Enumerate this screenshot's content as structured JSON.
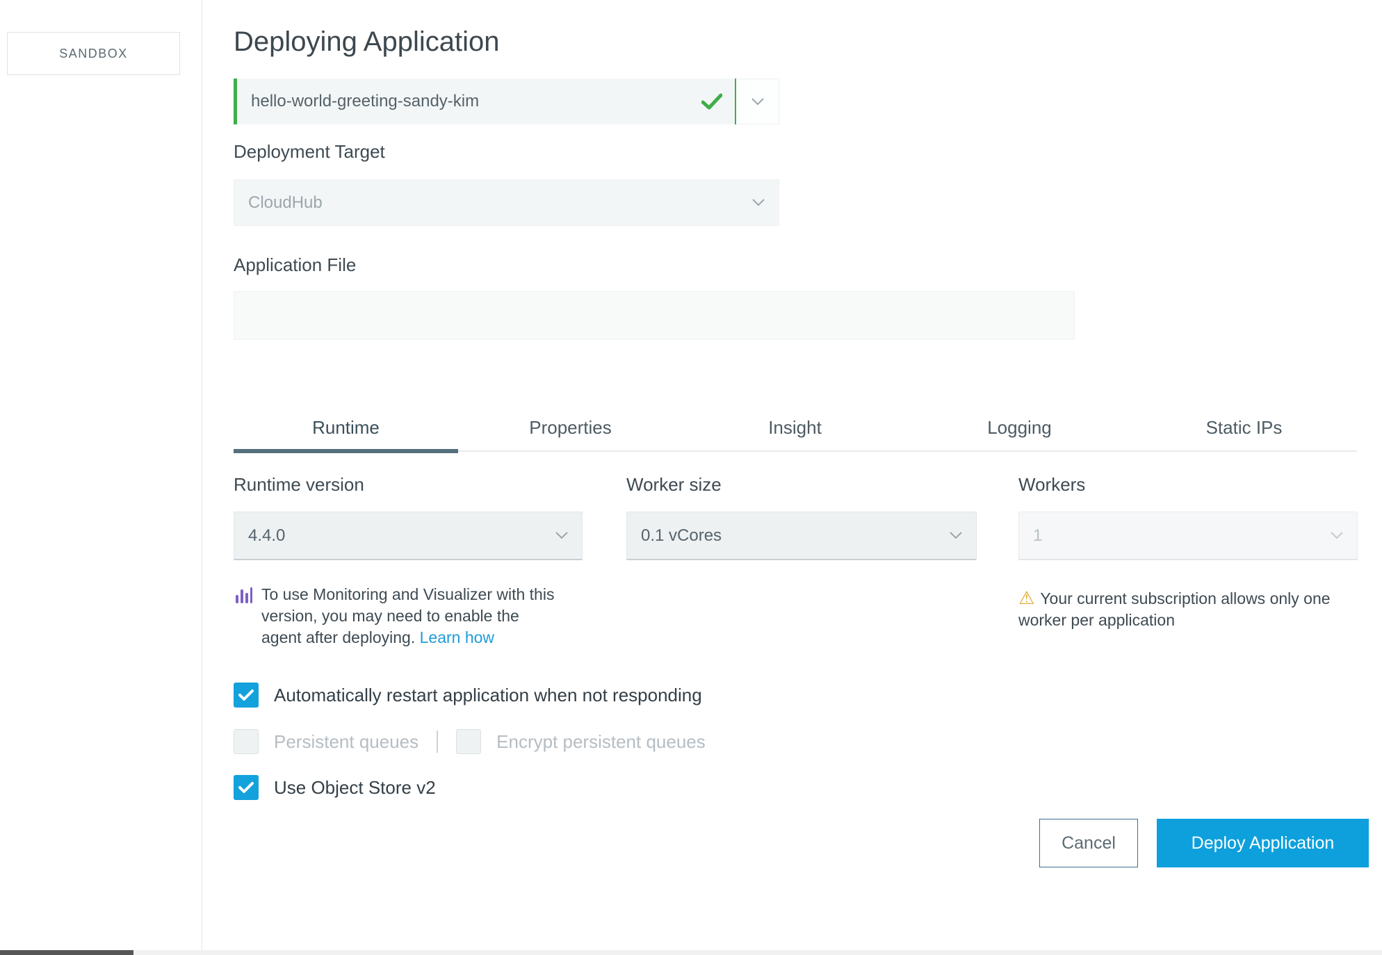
{
  "colors": {
    "accent_blue": "#0da0dd",
    "checkbox_blue": "#14a2dc",
    "success_green": "#3fae49",
    "warning_yellow": "#e1a62b",
    "link_blue": "#1f9cd8",
    "monitoring_purple": "#7d5fc7",
    "tab_active_underline": "#54707d"
  },
  "sidebar": {
    "environment_label": "SANDBOX"
  },
  "header": {
    "title": "Deploying Application"
  },
  "form": {
    "app_name": {
      "value": "hello-world-greeting-sandy-kim",
      "valid": true
    },
    "deployment_target": {
      "label": "Deployment Target",
      "value": "CloudHub"
    },
    "application_file": {
      "label": "Application File",
      "value": ""
    },
    "tabs": [
      {
        "label": "Runtime",
        "active": true
      },
      {
        "label": "Properties",
        "active": false
      },
      {
        "label": "Insight",
        "active": false
      },
      {
        "label": "Logging",
        "active": false
      },
      {
        "label": "Static IPs",
        "active": false
      }
    ],
    "runtime_tab": {
      "runtime_version": {
        "label": "Runtime version",
        "value": "4.4.0"
      },
      "worker_size": {
        "label": "Worker size",
        "value": "0.1 vCores"
      },
      "workers": {
        "label": "Workers",
        "value": "1",
        "disabled": true
      },
      "monitoring_note": {
        "text": "To use Monitoring and Visualizer with this\nversion, you may need to enable the\nagent after deploying.",
        "link_label": "Learn how"
      },
      "workers_warning": "Your current subscription allows only one\nworker per application",
      "checkboxes": [
        {
          "label": "Automatically restart application when not responding",
          "checked": true,
          "enabled": true
        },
        {
          "label": "Persistent queues",
          "checked": false,
          "enabled": false
        },
        {
          "label": "Encrypt persistent queues",
          "checked": false,
          "enabled": false
        },
        {
          "label": "Use Object Store v2",
          "checked": true,
          "enabled": true
        }
      ]
    },
    "actions": {
      "cancel_label": "Cancel",
      "deploy_label": "Deploy Application"
    }
  }
}
